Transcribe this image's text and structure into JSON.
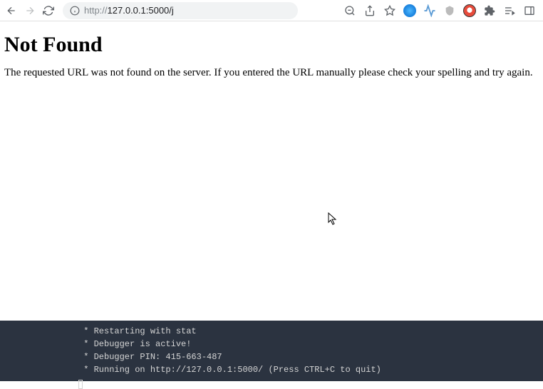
{
  "browser": {
    "url_full": "http://127.0.0.1:5000/j",
    "url_prefix": "http://",
    "url_main": "127.0.0.1:5000/j"
  },
  "page": {
    "heading": "Not Found",
    "message": "The requested URL was not found on the server. If you entered the URL manually please check your spelling and try again."
  },
  "terminal": {
    "lines": [
      " * Restarting with stat",
      " * Debugger is active!",
      " * Debugger PIN: 415-663-487",
      " * Running on http://127.0.0.1:5000/ (Press CTRL+C to quit)"
    ]
  }
}
